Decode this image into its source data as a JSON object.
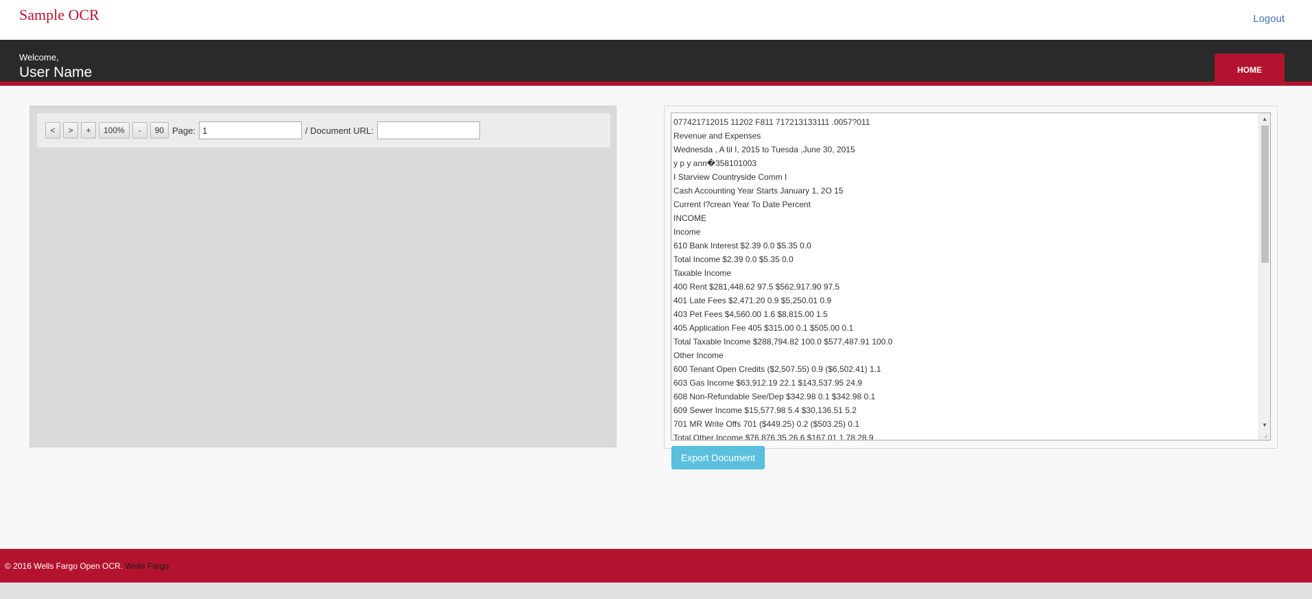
{
  "header": {
    "brand": "Sample OCR",
    "logout": "Logout"
  },
  "welcome": {
    "label": "Welcome,",
    "user_name": "User Name",
    "home_button": "HOME"
  },
  "viewer": {
    "toolbar": {
      "prev": "<",
      "next": ">",
      "zoom_in": "+",
      "zoom_level": "100%",
      "zoom_out": "-",
      "rotate": "90",
      "page_label": "Page:",
      "page_value": "1",
      "doc_url_label": "/ Document URL:",
      "doc_url_value": ""
    }
  },
  "ocr": {
    "lines": [
      "077421712015 11202 F811 717213133111 .0057?011",
      "Revenue and Expenses",
      "Wednesda , A til I, 2015 to Tuesda ,June 30, 2015",
      "y p y ann�358101003",
      "I Starview Countryside Comm I",
      "Cash Accounting Year Starts January 1, 2O 15",
      "Current I?crean Year To Date Percent",
      "INCOME",
      "Income",
      "610 Bank Interest $2.39 0.0 $5.35 0.0",
      "Total Income $2.39 0.0 $5.35 0.0",
      "Taxable Income",
      "400 Rent $281,448.62 97.5 $562,917.90 97.5",
      "401 Late Fees $2,471.20 0.9 $5,250.01 0.9",
      "403 Pet Fees $4,560.00 1.6 $8,815.00 1.5",
      "405 Application Fee 405 $315.00 0.1 $505.00 0.1",
      "Total Taxable Income $288,794.82 100.0 $577,487.91 100.0",
      "Other Income",
      "600 Tenant Open Credits ($2,507.55) 0.9 ($6,502.41) 1.1",
      "603 Gas Income $63,912.19 22.1 $143,537.95 24.9",
      "608 Non-Refundable See/Dep $342.98 0.1 $342.98 0.1",
      "609 Sewer Income $15,577.98 5.4 $30,136.51 5.2",
      "701 MR Write Offs 701 ($449.25) 0.2 ($503.25) 0.1",
      "Total Other Income $76,876.35 26.6 $167,01 1.78 28.9"
    ],
    "export_button": "Export Document"
  },
  "footer": {
    "copyright": "© 2016 Wells Fargo Open OCR.",
    "link": "Wells Fargo"
  }
}
